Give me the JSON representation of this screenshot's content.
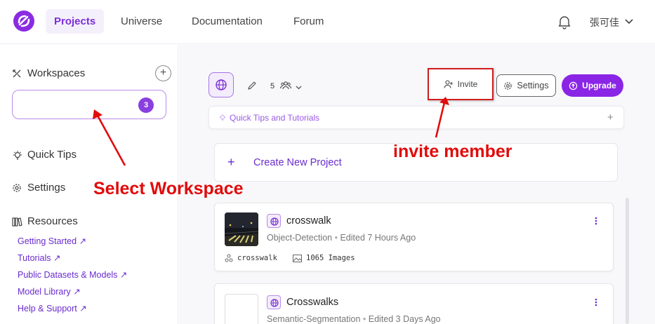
{
  "nav": {
    "tabs": [
      "Projects",
      "Universe",
      "Documentation",
      "Forum"
    ],
    "user_name": "張可佳"
  },
  "sidebar": {
    "workspaces_label": "Workspaces",
    "add_label": "+",
    "workspace_count": "3",
    "quick_tips": "Quick Tips",
    "settings": "Settings",
    "resources": "Resources",
    "resource_links": [
      "Getting Started",
      "Tutorials",
      "Public Datasets & Models",
      "Model Library",
      "Help & Support"
    ]
  },
  "toolbar": {
    "member_count": "5",
    "invite": "Invite",
    "settings": "Settings",
    "upgrade": "Upgrade"
  },
  "tips": {
    "label": "Quick Tips and Tutorials",
    "plus": "+"
  },
  "create": {
    "plus": "+",
    "label": "Create New Project"
  },
  "projects": [
    {
      "name": "crosswalk",
      "type": "Object-Detection",
      "edited": "Edited 7 Hours Ago",
      "tag": "crosswalk",
      "images": "1065 Images"
    },
    {
      "name": "Crosswalks",
      "type": "Semantic-Segmentation",
      "edited": "Edited 3 Days Ago"
    }
  ],
  "annotations": {
    "invite": "invite member",
    "workspace": "Select Workspace",
    "color": "#e10b0b"
  },
  "colors": {
    "accent": "#8a25e6",
    "link": "#6a2ccf"
  }
}
